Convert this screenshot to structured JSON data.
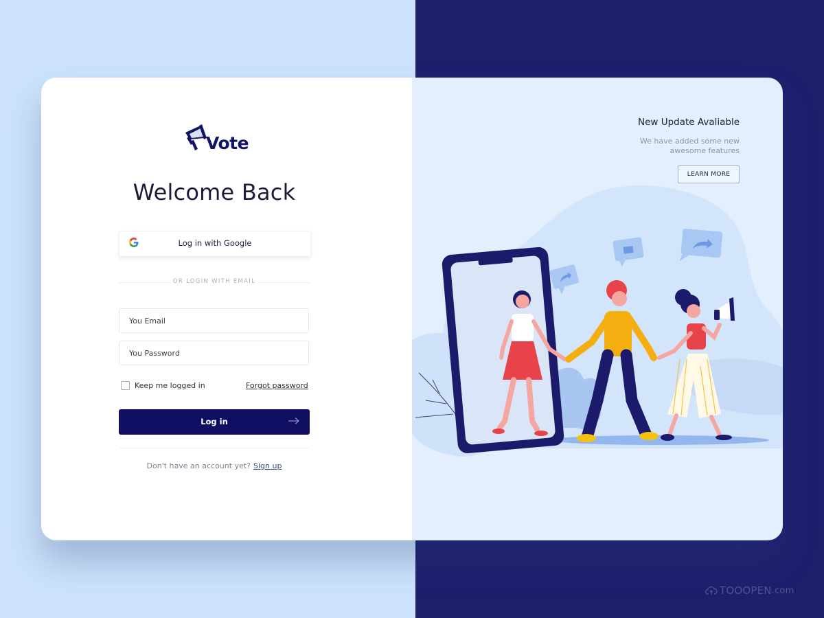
{
  "brand": {
    "name": "Vote",
    "logo_icon": "megaphone-icon"
  },
  "login": {
    "title": "Welcome Back",
    "google_button": {
      "label": "Log in with Google",
      "icon": "google-icon"
    },
    "divider_text": "OR LOGIN WITH EMAIL",
    "email_field": {
      "placeholder": "You Email",
      "value": ""
    },
    "password_field": {
      "placeholder": "You Password",
      "value": ""
    },
    "remember_me": {
      "label": "Keep me logged in",
      "checked": false
    },
    "forgot_password_label": "Forgot password",
    "submit_button": {
      "label": "Log in",
      "icon": "arrow-right-icon"
    },
    "signup_prompt": "Don't have an account yet?",
    "signup_link": "Sign up"
  },
  "update_panel": {
    "title": "New Update Avaliable",
    "description": "We have added some new awesome features",
    "button_label": "LEARN MORE"
  },
  "illustration": {
    "subject": "Three people walking out of a smartphone holding hands, one with a megaphone",
    "bubbles": [
      "share-icon",
      "thumbs-up-icon",
      "share-icon"
    ]
  },
  "colors": {
    "page_left_bg": "#cce3fb",
    "page_right_bg": "#1f1f6e",
    "primary": "#0f0e63",
    "right_panel_bg": "#e3effd",
    "text_dark": "#1c1c3a"
  },
  "watermark": {
    "text": "TOOOPEN",
    "suffix": ".com"
  }
}
